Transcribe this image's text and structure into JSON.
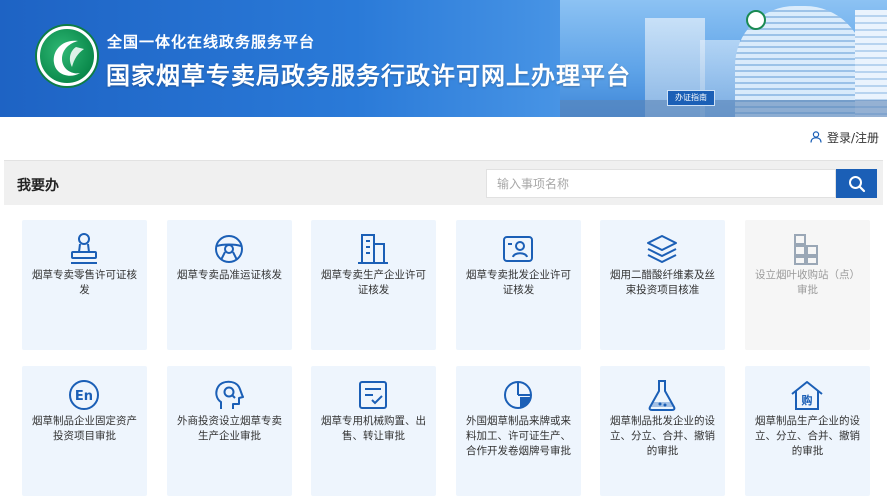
{
  "banner": {
    "subtitle": "全国一体化在线政务服务平台",
    "title": "国家烟草专卖局政务服务行政许可网上办理平台",
    "guide_label": "办证指南"
  },
  "header": {
    "login_label": "登录/注册"
  },
  "section": {
    "title": "我要办",
    "search_placeholder": "输入事项名称"
  },
  "services": [
    {
      "label": "烟草专卖零售许可证核发",
      "icon": "stamp-icon",
      "enabled": true
    },
    {
      "label": "烟草专卖品准运证核发",
      "icon": "steering-wheel-icon",
      "enabled": true
    },
    {
      "label": "烟草专卖生产企业许可证核发",
      "icon": "buildings-icon",
      "enabled": true
    },
    {
      "label": "烟草专卖批发企业许可证核发",
      "icon": "id-card-icon",
      "enabled": true
    },
    {
      "label": "烟用二醋酸纤维素及丝束投资项目核准",
      "icon": "layers-icon",
      "enabled": true
    },
    {
      "label": "设立烟叶收购站（点）审批",
      "icon": "grid-blocks-icon",
      "enabled": false
    },
    {
      "label": "烟草制品企业固定资产投资项目审批",
      "icon": "en-icon",
      "enabled": true
    },
    {
      "label": "外商投资设立烟草专卖生产企业审批",
      "icon": "head-search-icon",
      "enabled": true
    },
    {
      "label": "烟草专用机械购置、出售、转让审批",
      "icon": "checklist-icon",
      "enabled": true
    },
    {
      "label": "外国烟草制品来牌或来料加工、许可证生产、合作开发卷烟牌号审批",
      "icon": "pie-chart-icon",
      "enabled": true
    },
    {
      "label": "烟草制品批发企业的设立、分立、合并、撤销的审批",
      "icon": "flask-icon",
      "enabled": true
    },
    {
      "label": "烟草制品生产企业的设立、分立、合并、撤销的审批",
      "icon": "house-buy-icon",
      "enabled": true
    }
  ],
  "colors": {
    "primary": "#1b5fb6",
    "card_bg": "#eef5fd",
    "disabled_text": "#9a9a9a"
  }
}
